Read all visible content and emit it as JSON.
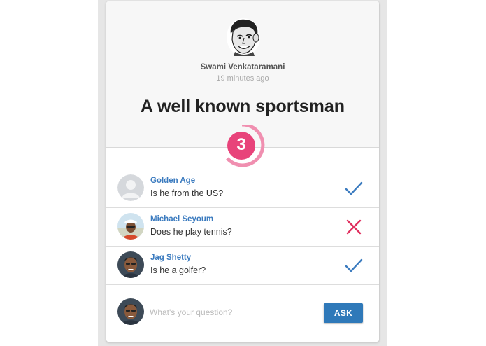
{
  "colors": {
    "accent": "#2f79b9",
    "counter": "#e8437a",
    "check": "#3b7bbf",
    "cross": "#e0305f"
  },
  "post": {
    "author": "Swami Venkataramani",
    "time": "19 minutes ago",
    "title": "A well known sportsman",
    "question_count": "3",
    "author_avatar_icon": "cartoon-face-icon"
  },
  "questions": [
    {
      "asker": "Golden Age",
      "text": "Is he from the US?",
      "answer": "yes",
      "avatar_icon": "default-user-icon"
    },
    {
      "asker": "Michael Seyoum",
      "text": "Does he play tennis?",
      "answer": "no",
      "avatar_icon": "user-photo-icon"
    },
    {
      "asker": "Jag Shetty",
      "text": "Is he a golfer?",
      "answer": "yes",
      "avatar_icon": "user-photo-icon"
    }
  ],
  "ask": {
    "placeholder": "What's your question?",
    "button_label": "ASK",
    "avatar_icon": "user-photo-icon"
  }
}
